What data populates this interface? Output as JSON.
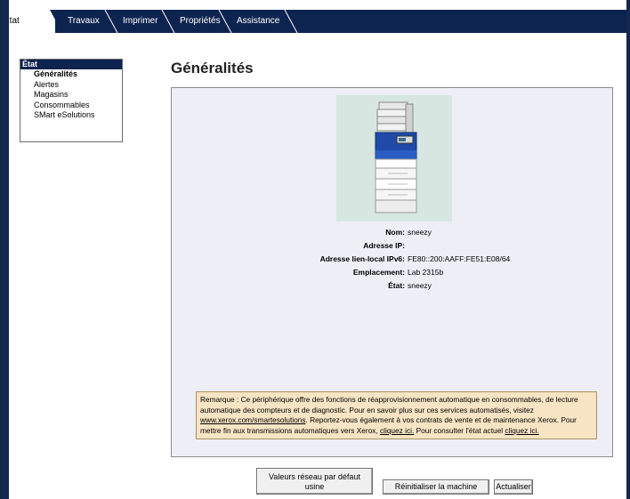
{
  "tabs": [
    {
      "label": "État"
    },
    {
      "label": "Travaux"
    },
    {
      "label": "Imprimer"
    },
    {
      "label": "Propriétés"
    },
    {
      "label": "Assistance"
    }
  ],
  "sidebar": {
    "header": "État",
    "items": [
      {
        "label": "Généralités"
      },
      {
        "label": "Alertes"
      },
      {
        "label": "Magasins"
      },
      {
        "label": "Consommables"
      },
      {
        "label": "SMart eSolutions"
      }
    ]
  },
  "main": {
    "title": "Généralités",
    "info": [
      {
        "label": "Nom:",
        "value": "sneezy"
      },
      {
        "label": "Adresse IP:",
        "value": ""
      },
      {
        "label": "Adresse lien-local IPv6:",
        "value": "FE80::200:AAFF:FE51:E08/64"
      },
      {
        "label": "Emplacement:",
        "value": "Lab 2315b"
      },
      {
        "label": "État:",
        "value": "sneezy"
      }
    ],
    "remark": {
      "text1": "Remarque : Ce périphérique offre des fonctions de réapprovisionnement automatique en consommables, de lecture automatique des compteurs et de diagnostic. Pour en savoir plus sur ces services automatisés, visitez ",
      "link1": "www.xerox.com/smartesolutions",
      "text2": ". Reportez-vous également à vos contrats de vente et de maintenance Xerox. Pour mettre fin aux transmissions automatiques vers Xerox, ",
      "link2": "cliquez ici.",
      "text3": " Pour consulter l'état actuel ",
      "link3": "cliquez ici."
    }
  },
  "buttons": {
    "defaults_line1": "Valeurs réseau par défaut",
    "defaults_line2": "usine",
    "reset": "Réinitialiser la machine",
    "refresh": "Actualiser"
  }
}
